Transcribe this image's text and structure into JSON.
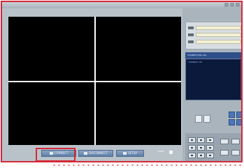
{
  "window": {
    "title": ""
  },
  "toolbar": {
    "buttons": [
      {
        "id": "connect",
        "label": "CONNECT",
        "icon": "connect-icon"
      },
      {
        "id": "disconnect",
        "label": "DISCONNECT",
        "icon": "disconnect-icon"
      },
      {
        "id": "setup",
        "label": "SETUP",
        "icon": "setup-icon"
      }
    ],
    "extra_label": "AUDIO"
  },
  "video": {
    "layout": "2x2",
    "channels": 4
  },
  "info_panel": {
    "fields": [
      "",
      "",
      ""
    ]
  },
  "log": {
    "header": "CONNECTION LOG",
    "lines": [
      "CONNECT OK"
    ]
  },
  "colors": {
    "highlight": "#d62839",
    "video_bg": "#000000",
    "accent": "#4b77b8"
  }
}
